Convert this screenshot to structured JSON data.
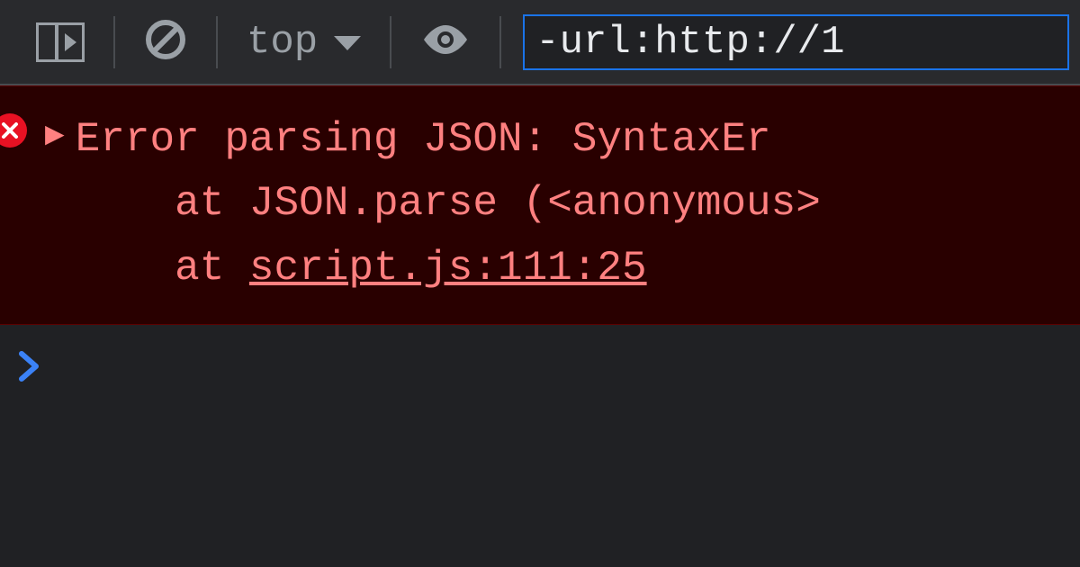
{
  "toolbar": {
    "context_label": "top",
    "filter_value": "-url:http://1"
  },
  "error": {
    "line1": "Error parsing JSON: SyntaxEr",
    "line2_prefix": "    at JSON.parse (",
    "line2_anon": "<anonymous>",
    "line3_prefix": "    at ",
    "line3_link": "script.js:111:25"
  }
}
